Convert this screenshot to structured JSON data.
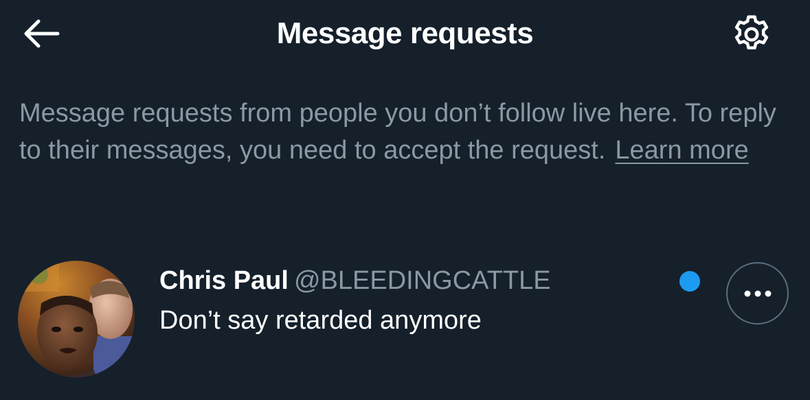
{
  "header": {
    "title": "Message requests",
    "back_icon": "arrow-left-icon",
    "settings_icon": "gear-icon"
  },
  "info": {
    "text": "Message requests from people you don’t follow live here. To reply to their messages, you need to accept the request.",
    "learn_more": "Learn more"
  },
  "requests": [
    {
      "name": "Chris Paul",
      "handle": "@BLEEDINGCATTLE",
      "message": "Don’t say retarded anymore",
      "unread": true,
      "more_icon": "more-horizontal-icon"
    }
  ],
  "colors": {
    "background": "#15202b",
    "text_primary": "#ffffff",
    "text_secondary": "#8b98a5",
    "accent": "#1d9bf0"
  }
}
